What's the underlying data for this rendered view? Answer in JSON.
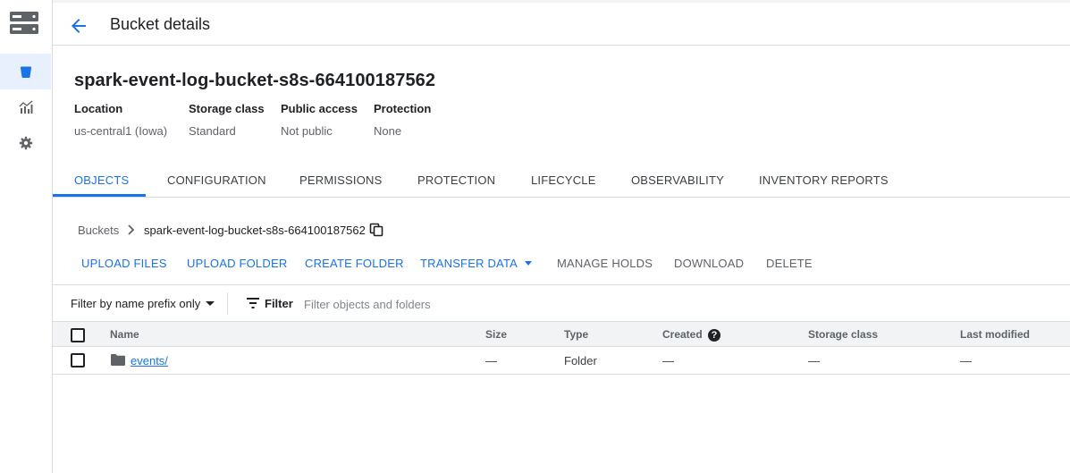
{
  "header": {
    "title": "Bucket details"
  },
  "bucket": {
    "name": "spark-event-log-bucket-s8s-664100187562",
    "meta": [
      {
        "key": "Location",
        "value": "us-central1 (Iowa)"
      },
      {
        "key": "Storage class",
        "value": "Standard"
      },
      {
        "key": "Public access",
        "value": "Not public"
      },
      {
        "key": "Protection",
        "value": "None"
      }
    ]
  },
  "tabs": [
    "OBJECTS",
    "CONFIGURATION",
    "PERMISSIONS",
    "PROTECTION",
    "LIFECYCLE",
    "OBSERVABILITY",
    "INVENTORY REPORTS"
  ],
  "active_tab": "OBJECTS",
  "breadcrumb": {
    "root": "Buckets",
    "current": "spark-event-log-bucket-s8s-664100187562"
  },
  "actions": {
    "upload_files": "UPLOAD FILES",
    "upload_folder": "UPLOAD FOLDER",
    "create_folder": "CREATE FOLDER",
    "transfer_data": "TRANSFER DATA",
    "manage_holds": "MANAGE HOLDS",
    "download": "DOWNLOAD",
    "delete": "DELETE"
  },
  "filter": {
    "prefix_option": "Filter by name prefix only",
    "label": "Filter",
    "placeholder": "Filter objects and folders"
  },
  "table": {
    "columns": [
      "Name",
      "Size",
      "Type",
      "Created",
      "Storage class",
      "Last modified"
    ],
    "help_glyph": "?",
    "rows": [
      {
        "name": "events/",
        "size": "—",
        "type": "Folder",
        "created": "—",
        "storage_class": "—",
        "last_modified": "—"
      }
    ]
  },
  "icons": {
    "logo": "storage-icon",
    "rail": [
      "bucket-icon",
      "monitoring-icon",
      "settings-icon"
    ]
  },
  "colors": {
    "accent": "#1a73e8",
    "rail_active_bg": "#e8f0fe",
    "header_bg": "#f1f3f4"
  }
}
